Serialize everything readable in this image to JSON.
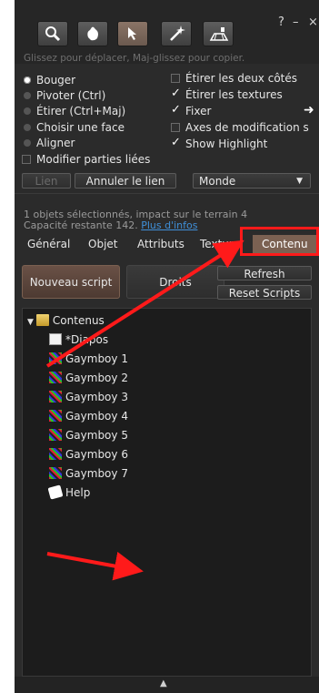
{
  "window": {
    "help": "?",
    "minimize": "–",
    "close": "×"
  },
  "toolbar": {
    "tools": [
      {
        "name": "focus-tool-button",
        "icon": "magnifier-icon"
      },
      {
        "name": "move-tool-button",
        "icon": "grab-hand-icon"
      },
      {
        "name": "edit-tool-button",
        "icon": "cursor-arrow-icon"
      },
      {
        "name": "create-tool-button",
        "icon": "magic-wand-icon"
      },
      {
        "name": "land-tool-button",
        "icon": "land-tool-icon"
      }
    ]
  },
  "hint": "Glissez pour déplacer, Maj-glissez pour copier.",
  "mode_options": {
    "move": "Bouger",
    "rotate": "Pivoter (Ctrl)",
    "stretch": "Étirer (Ctrl+Maj)",
    "select_face": "Choisir une face",
    "align": "Aligner",
    "selected": "Bouger"
  },
  "checkboxes": {
    "stretch_both_sides": {
      "label": "Étirer les deux côtés",
      "checked": false
    },
    "stretch_textures": {
      "label": "Étirer les textures",
      "checked": true
    },
    "snap": {
      "label": "Fixer",
      "checked": true
    },
    "modify_axes": {
      "label": "Axes de modification s",
      "checked": false
    },
    "show_highlight": {
      "label": "Show Highlight",
      "checked": true
    },
    "modify_linked": {
      "label": "Modifier parties liées",
      "checked": false
    }
  },
  "buttons": {
    "link": "Lien",
    "unlink": "Annuler le lien",
    "grid_select": "Monde"
  },
  "info": {
    "selection": "1 objets sélectionnés, impact sur le terrain 4",
    "capacity": "Capacité restante 142.",
    "more_info": "Plus d'infos"
  },
  "tabs": [
    "Général",
    "Objet",
    "Attributs",
    "Texture",
    "Contenu"
  ],
  "active_tab": "Contenu",
  "contents": {
    "new_script": "Nouveau script",
    "permissions": "Droits",
    "refresh": "Refresh",
    "reset_scripts": "Reset Scripts",
    "root_folder": "Contenus",
    "items": [
      {
        "label": "*Diapos",
        "type": "script"
      },
      {
        "label": "Gaymboy 1",
        "type": "texture"
      },
      {
        "label": "Gaymboy 2",
        "type": "texture"
      },
      {
        "label": "Gaymboy 3",
        "type": "texture"
      },
      {
        "label": "Gaymboy 4",
        "type": "texture"
      },
      {
        "label": "Gaymboy 5",
        "type": "texture"
      },
      {
        "label": "Gaymboy 6",
        "type": "texture"
      },
      {
        "label": "Gaymboy 7",
        "type": "texture"
      },
      {
        "label": "Help",
        "type": "notecard"
      }
    ]
  },
  "colors": {
    "panel": "#2b2b2b",
    "active_tab": "#7b6152",
    "annotation": "#ff1a1a",
    "link": "#3f8fd8"
  }
}
